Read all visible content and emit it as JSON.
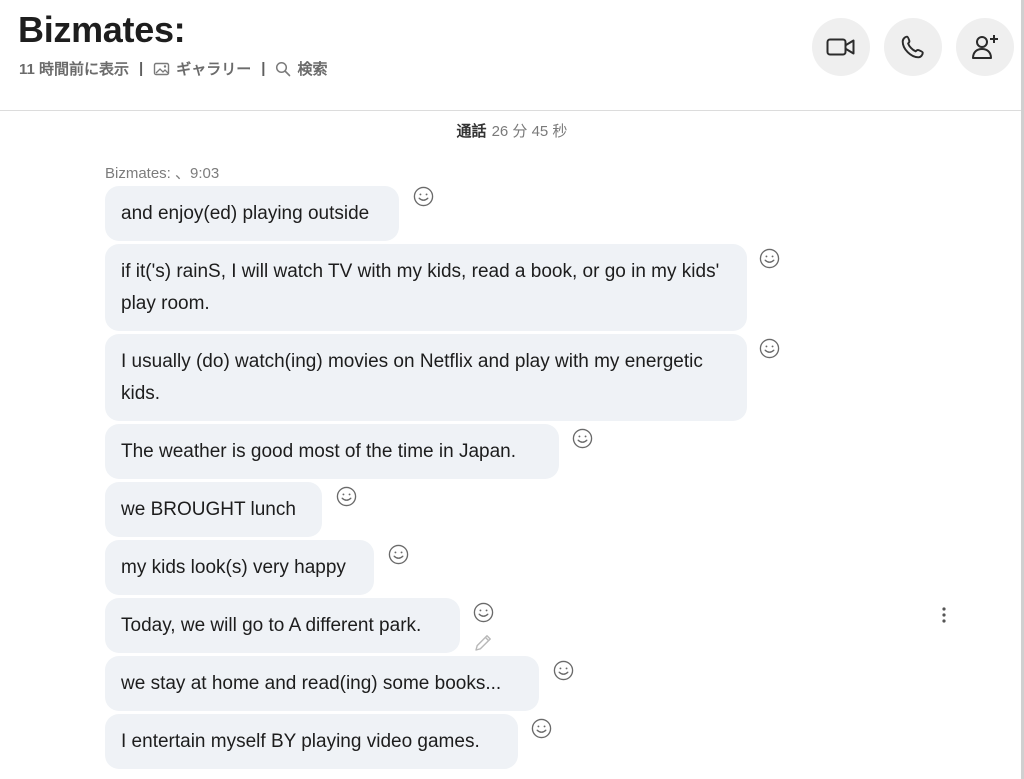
{
  "header": {
    "title": "Bizmates:",
    "last_seen": "11 時間前に表示",
    "separator": "|",
    "gallery_label": "ギャラリー",
    "search_label": "検索",
    "video_call_icon": "video-camera-icon",
    "voice_call_icon": "phone-icon",
    "add_person_icon": "add-person-icon"
  },
  "call": {
    "label": "通話",
    "duration": "26 分 45 秒"
  },
  "sender_line": "Bizmates: 、9:03",
  "messages": [
    {
      "text": "and enjoy(ed) playing outside"
    },
    {
      "text": "if it('s) rainS, I will watch TV with my kids, read a book, or go in my kids' play room."
    },
    {
      "text": "I usually (do) watch(ing) movies on Netflix and play with my energetic kids."
    },
    {
      "text": "The weather is good most of the time in Japan."
    },
    {
      "text": "we BROUGHT lunch"
    },
    {
      "text": "my kids look(s) very happy"
    },
    {
      "text": "Today, we will go to A different park."
    },
    {
      "text": "we stay at home and read(ing) some books..."
    },
    {
      "text": "I entertain myself BY playing video games."
    }
  ],
  "colors": {
    "bubble": "#eff2f6",
    "header_button": "#efefef",
    "muted_text": "#6b6b6b"
  }
}
